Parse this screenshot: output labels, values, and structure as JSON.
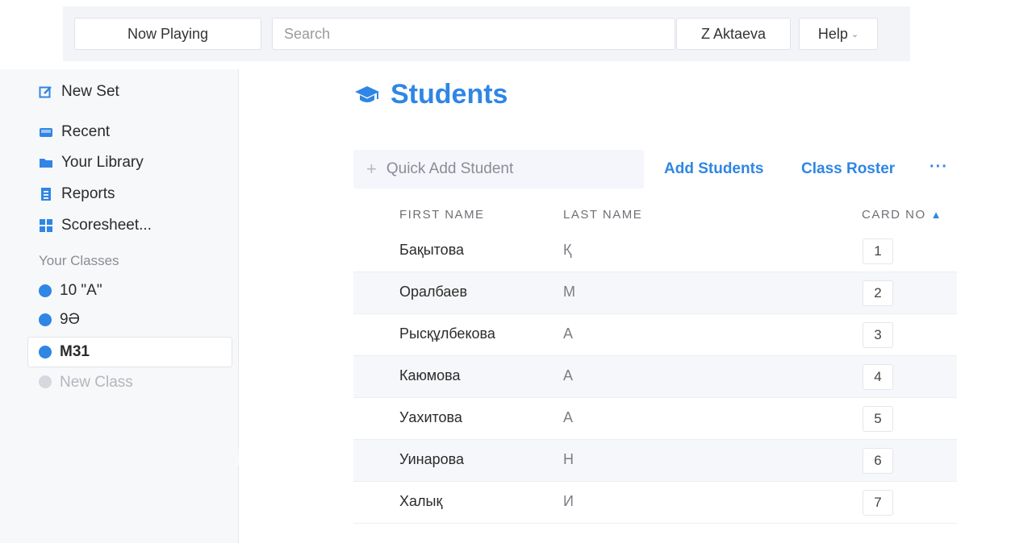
{
  "header": {
    "now_playing": "Now Playing",
    "search_placeholder": "Search",
    "user": "Z Aktaeva",
    "help": "Help"
  },
  "sidebar": {
    "items": [
      {
        "label": "New Set",
        "icon": "edit-icon"
      },
      {
        "label": "Recent",
        "icon": "recent-icon"
      },
      {
        "label": "Your Library",
        "icon": "folder-icon"
      },
      {
        "label": "Reports",
        "icon": "report-icon"
      },
      {
        "label": "Scoresheet...",
        "icon": "grid-icon"
      }
    ],
    "section_label": "Your Classes",
    "classes": [
      {
        "label": "10 \"A\""
      },
      {
        "label": "9Ә"
      },
      {
        "label": "M31"
      }
    ],
    "new_class": "New Class"
  },
  "main": {
    "title": "Students",
    "quick_add_placeholder": "Quick Add Student",
    "add_students": "Add Students",
    "class_roster": "Class Roster",
    "more": "···",
    "columns": {
      "first": "FIRST NAME",
      "last": "LAST NAME",
      "card": "CARD NO"
    },
    "students": [
      {
        "first": "Бақытова",
        "last": "Қ",
        "card": "1"
      },
      {
        "first": "Оралбаев",
        "last": "М",
        "card": "2"
      },
      {
        "first": "Рысқұлбекова",
        "last": "А",
        "card": "3"
      },
      {
        "first": "Каюмова",
        "last": "А",
        "card": "4"
      },
      {
        "first": "Уахитова",
        "last": "А",
        "card": "5"
      },
      {
        "first": "Уинарова",
        "last": "Н",
        "card": "6"
      },
      {
        "first": "Халық",
        "last": "И",
        "card": "7"
      }
    ]
  },
  "colors": {
    "accent": "#2f86e4",
    "sidebar_bg": "#f7f8fa",
    "topbar_bg": "#f3f4f8"
  }
}
